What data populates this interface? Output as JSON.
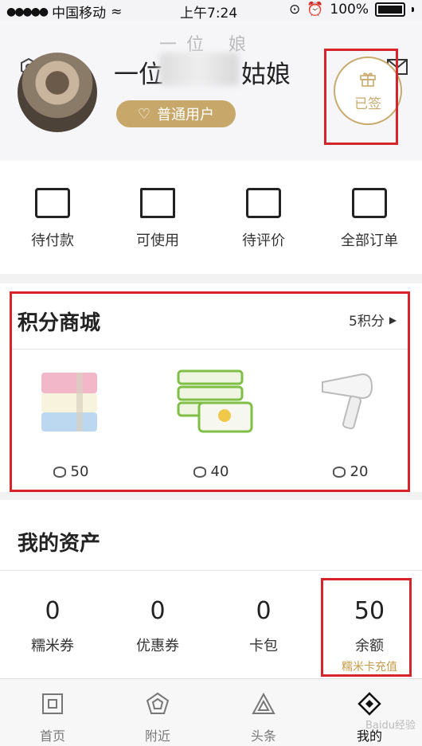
{
  "status_bar": {
    "carrier": "中国移动",
    "time": "上午7:24",
    "battery": "100%"
  },
  "profile": {
    "name_start": "一位",
    "name_end": "姑娘",
    "ghost_name": "一位  娘",
    "user_tier": "普通用户",
    "signin_label": "已签"
  },
  "orders": [
    {
      "label": "待付款",
      "icon": "wallet-icon"
    },
    {
      "label": "可使用",
      "icon": "ticket-icon"
    },
    {
      "label": "待评价",
      "icon": "comment-icon"
    },
    {
      "label": "全部订单",
      "icon": "order-list-icon"
    }
  ],
  "points_mall": {
    "title": "积分商城",
    "points": "5积分",
    "products": [
      {
        "name": "towels",
        "price": "50"
      },
      {
        "name": "wet-wipes",
        "price": "40"
      },
      {
        "name": "hair-dryer",
        "price": "20"
      }
    ]
  },
  "assets": {
    "title": "我的资产",
    "items": [
      {
        "value": "0",
        "label": "糯米券",
        "sub": ""
      },
      {
        "value": "0",
        "label": "优惠券",
        "sub": ""
      },
      {
        "value": "0",
        "label": "卡包",
        "sub": ""
      },
      {
        "value": "50",
        "label": "余额",
        "sub": "糯米卡充值"
      }
    ]
  },
  "tabbar": [
    {
      "label": "首页",
      "icon": "home-icon"
    },
    {
      "label": "附近",
      "icon": "nearby-icon"
    },
    {
      "label": "头条",
      "icon": "headline-icon"
    },
    {
      "label": "我的",
      "icon": "mine-icon",
      "active": true
    }
  ],
  "watermark": "Baidu经验",
  "colors": {
    "accent_gold": "#c7a86a",
    "highlight_red": "#d6252a"
  }
}
